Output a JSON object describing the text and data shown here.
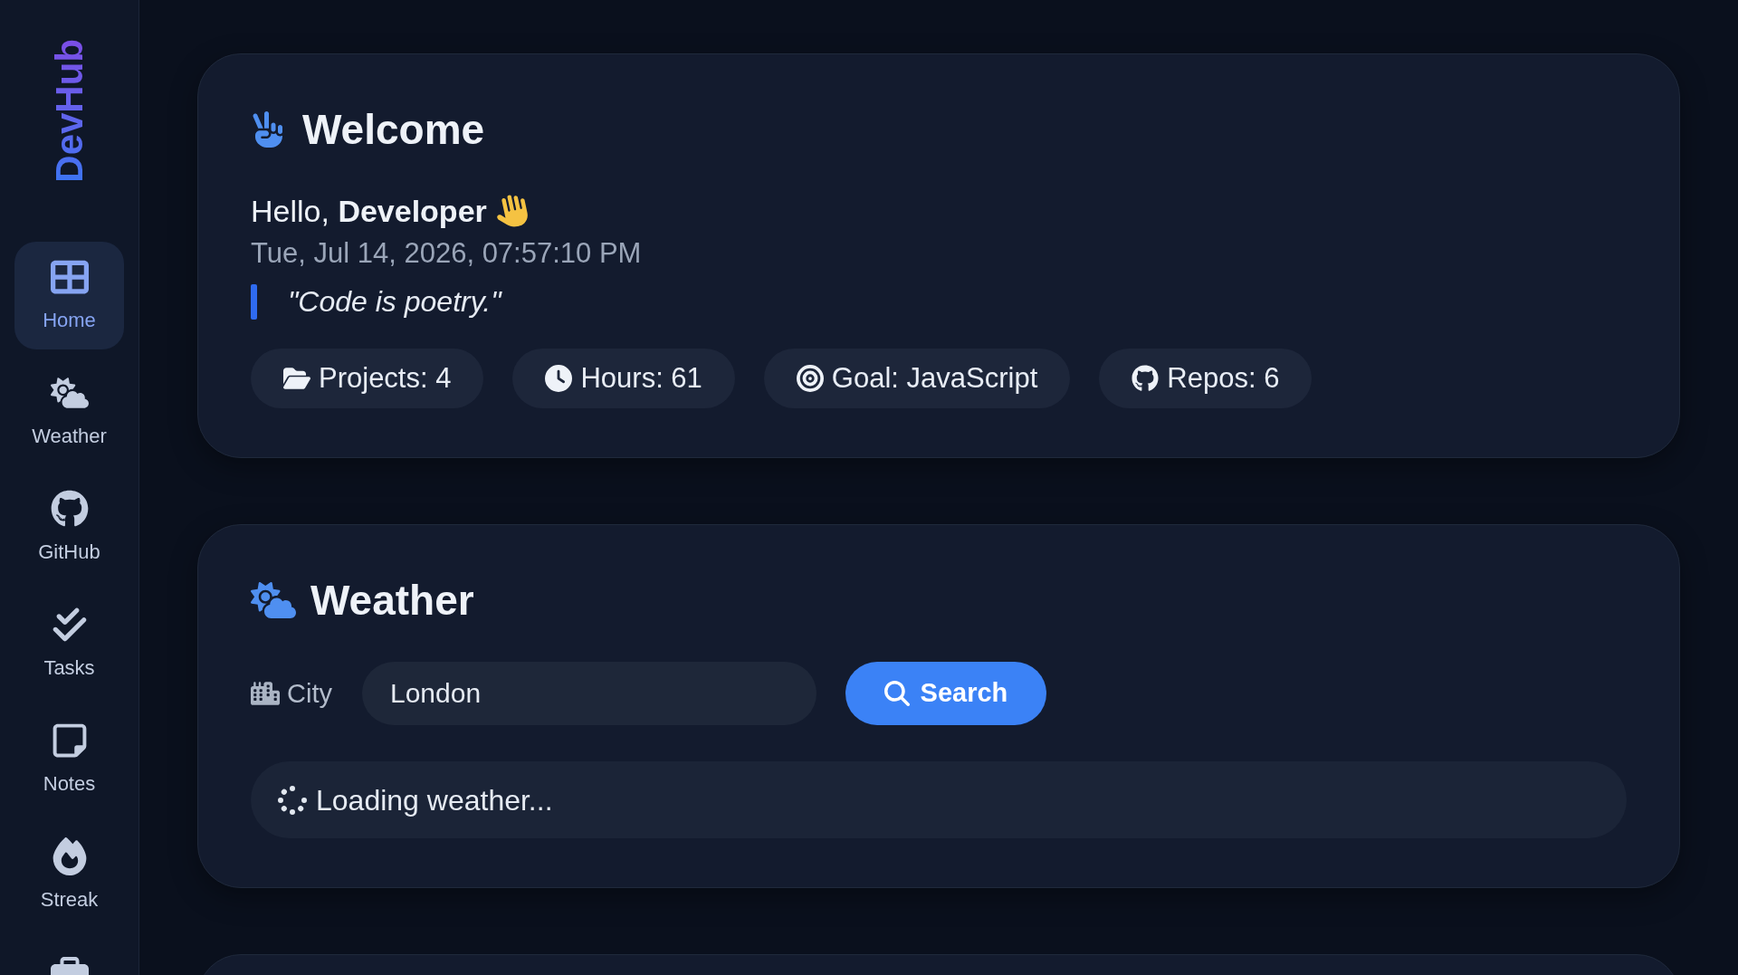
{
  "sidebar": {
    "logo": "DevHub",
    "items": [
      {
        "label": "Home",
        "selected": true
      },
      {
        "label": "Weather",
        "selected": false
      },
      {
        "label": "GitHub",
        "selected": false
      },
      {
        "label": "Tasks",
        "selected": false
      },
      {
        "label": "Notes",
        "selected": false
      },
      {
        "label": "Streak",
        "selected": false
      }
    ]
  },
  "welcome_card": {
    "title": "Welcome",
    "greeting": "Hello, **Developer**",
    "datetime": "Tue, Jul 14, 2026, 07:57:10 PM",
    "quote": "\"Code is poetry.\"",
    "stats": [
      "Projects: 4",
      "Hours: 61",
      "Goal: JavaScript",
      "Repos: 6"
    ]
  },
  "weather_card": {
    "title": "Weather",
    "city_label": "City",
    "city_input": {
      "value": "London"
    },
    "search_button": "Search",
    "status": "Loading weather..."
  }
}
